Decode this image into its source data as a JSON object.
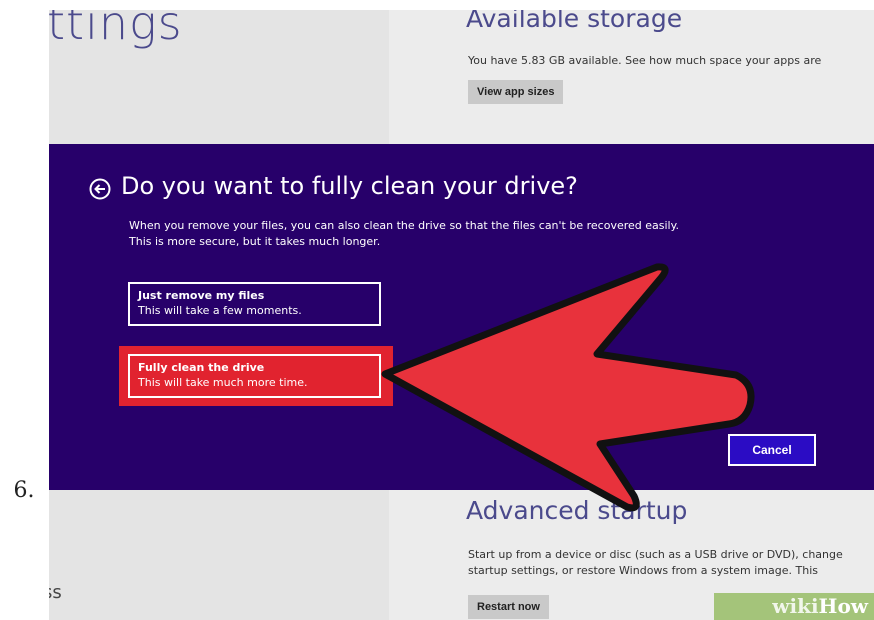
{
  "step_number": "6.",
  "background": {
    "title_fragment": "ttings",
    "left_bottom_fragment": "ss",
    "available_storage": {
      "title": "Available storage",
      "text": "You have 5.83 GB available. See how much space your apps are",
      "button": "View app sizes"
    },
    "advanced_startup": {
      "title": "Advanced startup",
      "line1": "Start up from a device or disc (such as a USB drive or DVD), change",
      "line2": "startup settings, or restore Windows from a system image. This",
      "button": "Restart now"
    }
  },
  "dialog": {
    "title": "Do you want to fully clean your drive?",
    "description_line1": "When you remove your files, you can also clean the drive so that the files can't be recovered easily.",
    "description_line2": "This is more secure, but it takes much longer.",
    "options": [
      {
        "label": "Just remove my files",
        "sub": "This will take a few moments."
      },
      {
        "label": "Fully clean the drive",
        "sub": "This will take much more time."
      }
    ],
    "cancel": "Cancel"
  },
  "watermark": {
    "part1": "wiki",
    "part2": "How"
  },
  "colors": {
    "dialog_bg": "#27006a",
    "highlight": "#e1232f",
    "arrow": "#e8323c",
    "cancel_bg": "#2b0cc4",
    "accent_text": "#4b4a8c"
  },
  "icons": {
    "back": "back-arrow-circle-icon",
    "pointer": "red-arrow-annotation"
  }
}
